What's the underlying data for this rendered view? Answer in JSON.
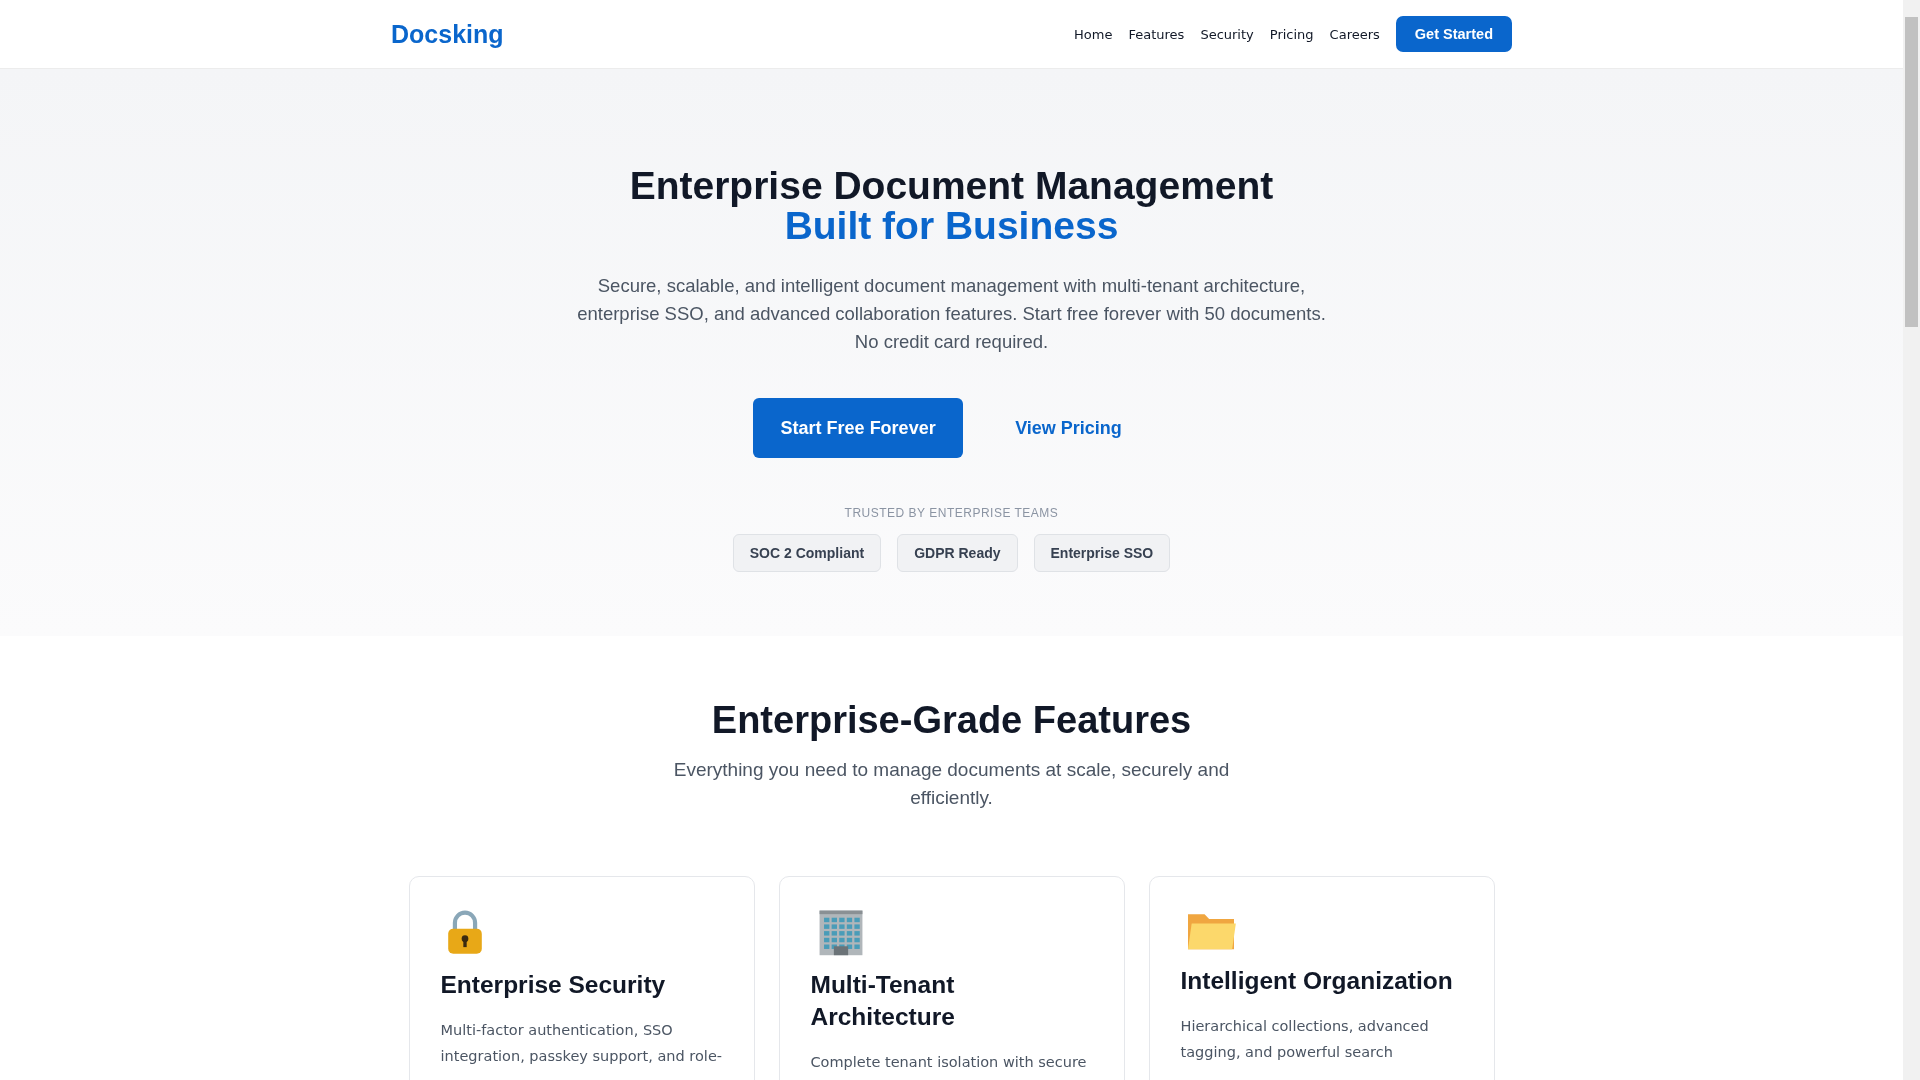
{
  "header": {
    "logo": "Docsking",
    "nav": [
      "Home",
      "Features",
      "Security",
      "Pricing",
      "Careers"
    ],
    "cta": "Get Started"
  },
  "hero": {
    "title": "Enterprise Document Management",
    "title_accent": "Built for Business",
    "text": "Secure, scalable, and intelligent document management with multi-tenant architecture, enterprise SSO, and advanced collaboration features. Start free forever with 50 documents. No credit card required.",
    "primary_button": "Start Free Forever",
    "secondary_button": "View Pricing",
    "trusted_label": "TRUSTED BY ENTERPRISE TEAMS",
    "badges": [
      "SOC 2 Compliant",
      "GDPR Ready",
      "Enterprise SSO"
    ]
  },
  "features": {
    "title": "Enterprise-Grade Features",
    "subtitle": "Everything you need to manage documents at scale, securely and efficiently.",
    "cards": [
      {
        "kind": "lock",
        "title": "Enterprise Security",
        "text": "Multi-factor authentication, SSO integration, passkey support, and role-"
      },
      {
        "kind": "building",
        "title": "Multi-Tenant Architecture",
        "text": "Complete tenant isolation with secure"
      },
      {
        "kind": "folder",
        "title": "Intelligent Organization",
        "text": "Hierarchical collections, advanced tagging, and powerful search"
      }
    ]
  }
}
